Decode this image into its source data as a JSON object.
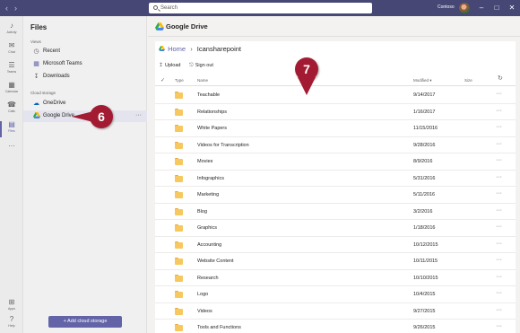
{
  "titlebar": {
    "back_icon": "chevron-left-icon",
    "forward_icon": "chevron-right-icon",
    "search_placeholder": "Search",
    "tenant": "Contoso",
    "minimize": "–",
    "maximize": "□",
    "close": "✕"
  },
  "rail": {
    "items": [
      {
        "label": "Activity",
        "icon": "♪"
      },
      {
        "label": "Chat",
        "icon": "✉"
      },
      {
        "label": "Teams",
        "icon": "☰"
      },
      {
        "label": "Calendar",
        "icon": "▦"
      },
      {
        "label": "Calls",
        "icon": "☎"
      },
      {
        "label": "Files",
        "icon": "▤"
      },
      {
        "label": "",
        "icon": "…"
      }
    ],
    "bottom": [
      {
        "label": "Apps",
        "icon": "⊞"
      },
      {
        "label": "Help",
        "icon": "?"
      }
    ]
  },
  "files_panel": {
    "title": "Files",
    "views_label": "Views",
    "views": [
      {
        "label": "Recent",
        "icon": "clock-icon"
      },
      {
        "label": "Microsoft Teams",
        "icon": "teams-icon"
      },
      {
        "label": "Downloads",
        "icon": "download-icon"
      }
    ],
    "cloud_label": "Cloud storage",
    "cloud": [
      {
        "label": "OneDrive",
        "icon": "cloud-icon"
      },
      {
        "label": "Google Drive",
        "icon": "google-drive-icon"
      }
    ],
    "more": "···",
    "add_button": "+   Add cloud storage"
  },
  "main": {
    "header_title": "Google Drive",
    "breadcrumb": {
      "home": "Home",
      "separator": "›",
      "current": "Icansharepoint"
    },
    "toolbar": {
      "upload": "Upload",
      "signout": "Sign out"
    },
    "columns": {
      "check": "✓",
      "type": "Type",
      "name": "Name",
      "modified": "Modified ▾",
      "size": "Size",
      "refresh": "↻"
    },
    "rows": [
      {
        "name": "Teachable",
        "modified": "9/14/2017"
      },
      {
        "name": "Relationships",
        "modified": "1/16/2017"
      },
      {
        "name": "White Papers",
        "modified": "11/15/2016"
      },
      {
        "name": "Videos for Transcription",
        "modified": "9/28/2016"
      },
      {
        "name": "Movies",
        "modified": "8/9/2016"
      },
      {
        "name": "Infographics",
        "modified": "5/31/2016"
      },
      {
        "name": "Marketing",
        "modified": "5/11/2016"
      },
      {
        "name": "Blog",
        "modified": "3/2/2016"
      },
      {
        "name": "Graphics",
        "modified": "1/18/2016"
      },
      {
        "name": "Accounting",
        "modified": "10/12/2015"
      },
      {
        "name": "Website Content",
        "modified": "10/11/2015"
      },
      {
        "name": "Research",
        "modified": "10/10/2015"
      },
      {
        "name": "Logo",
        "modified": "10/4/2015"
      },
      {
        "name": "Videos",
        "modified": "9/27/2015"
      },
      {
        "name": "Tools and Functions",
        "modified": "9/26/2015"
      }
    ],
    "row_more": "···"
  },
  "callouts": {
    "six": "6",
    "seven": "7"
  },
  "colors": {
    "accent": "#6264a7",
    "titlebar": "#464775",
    "callout": "#a31b32",
    "folder": "#f6c85f"
  }
}
